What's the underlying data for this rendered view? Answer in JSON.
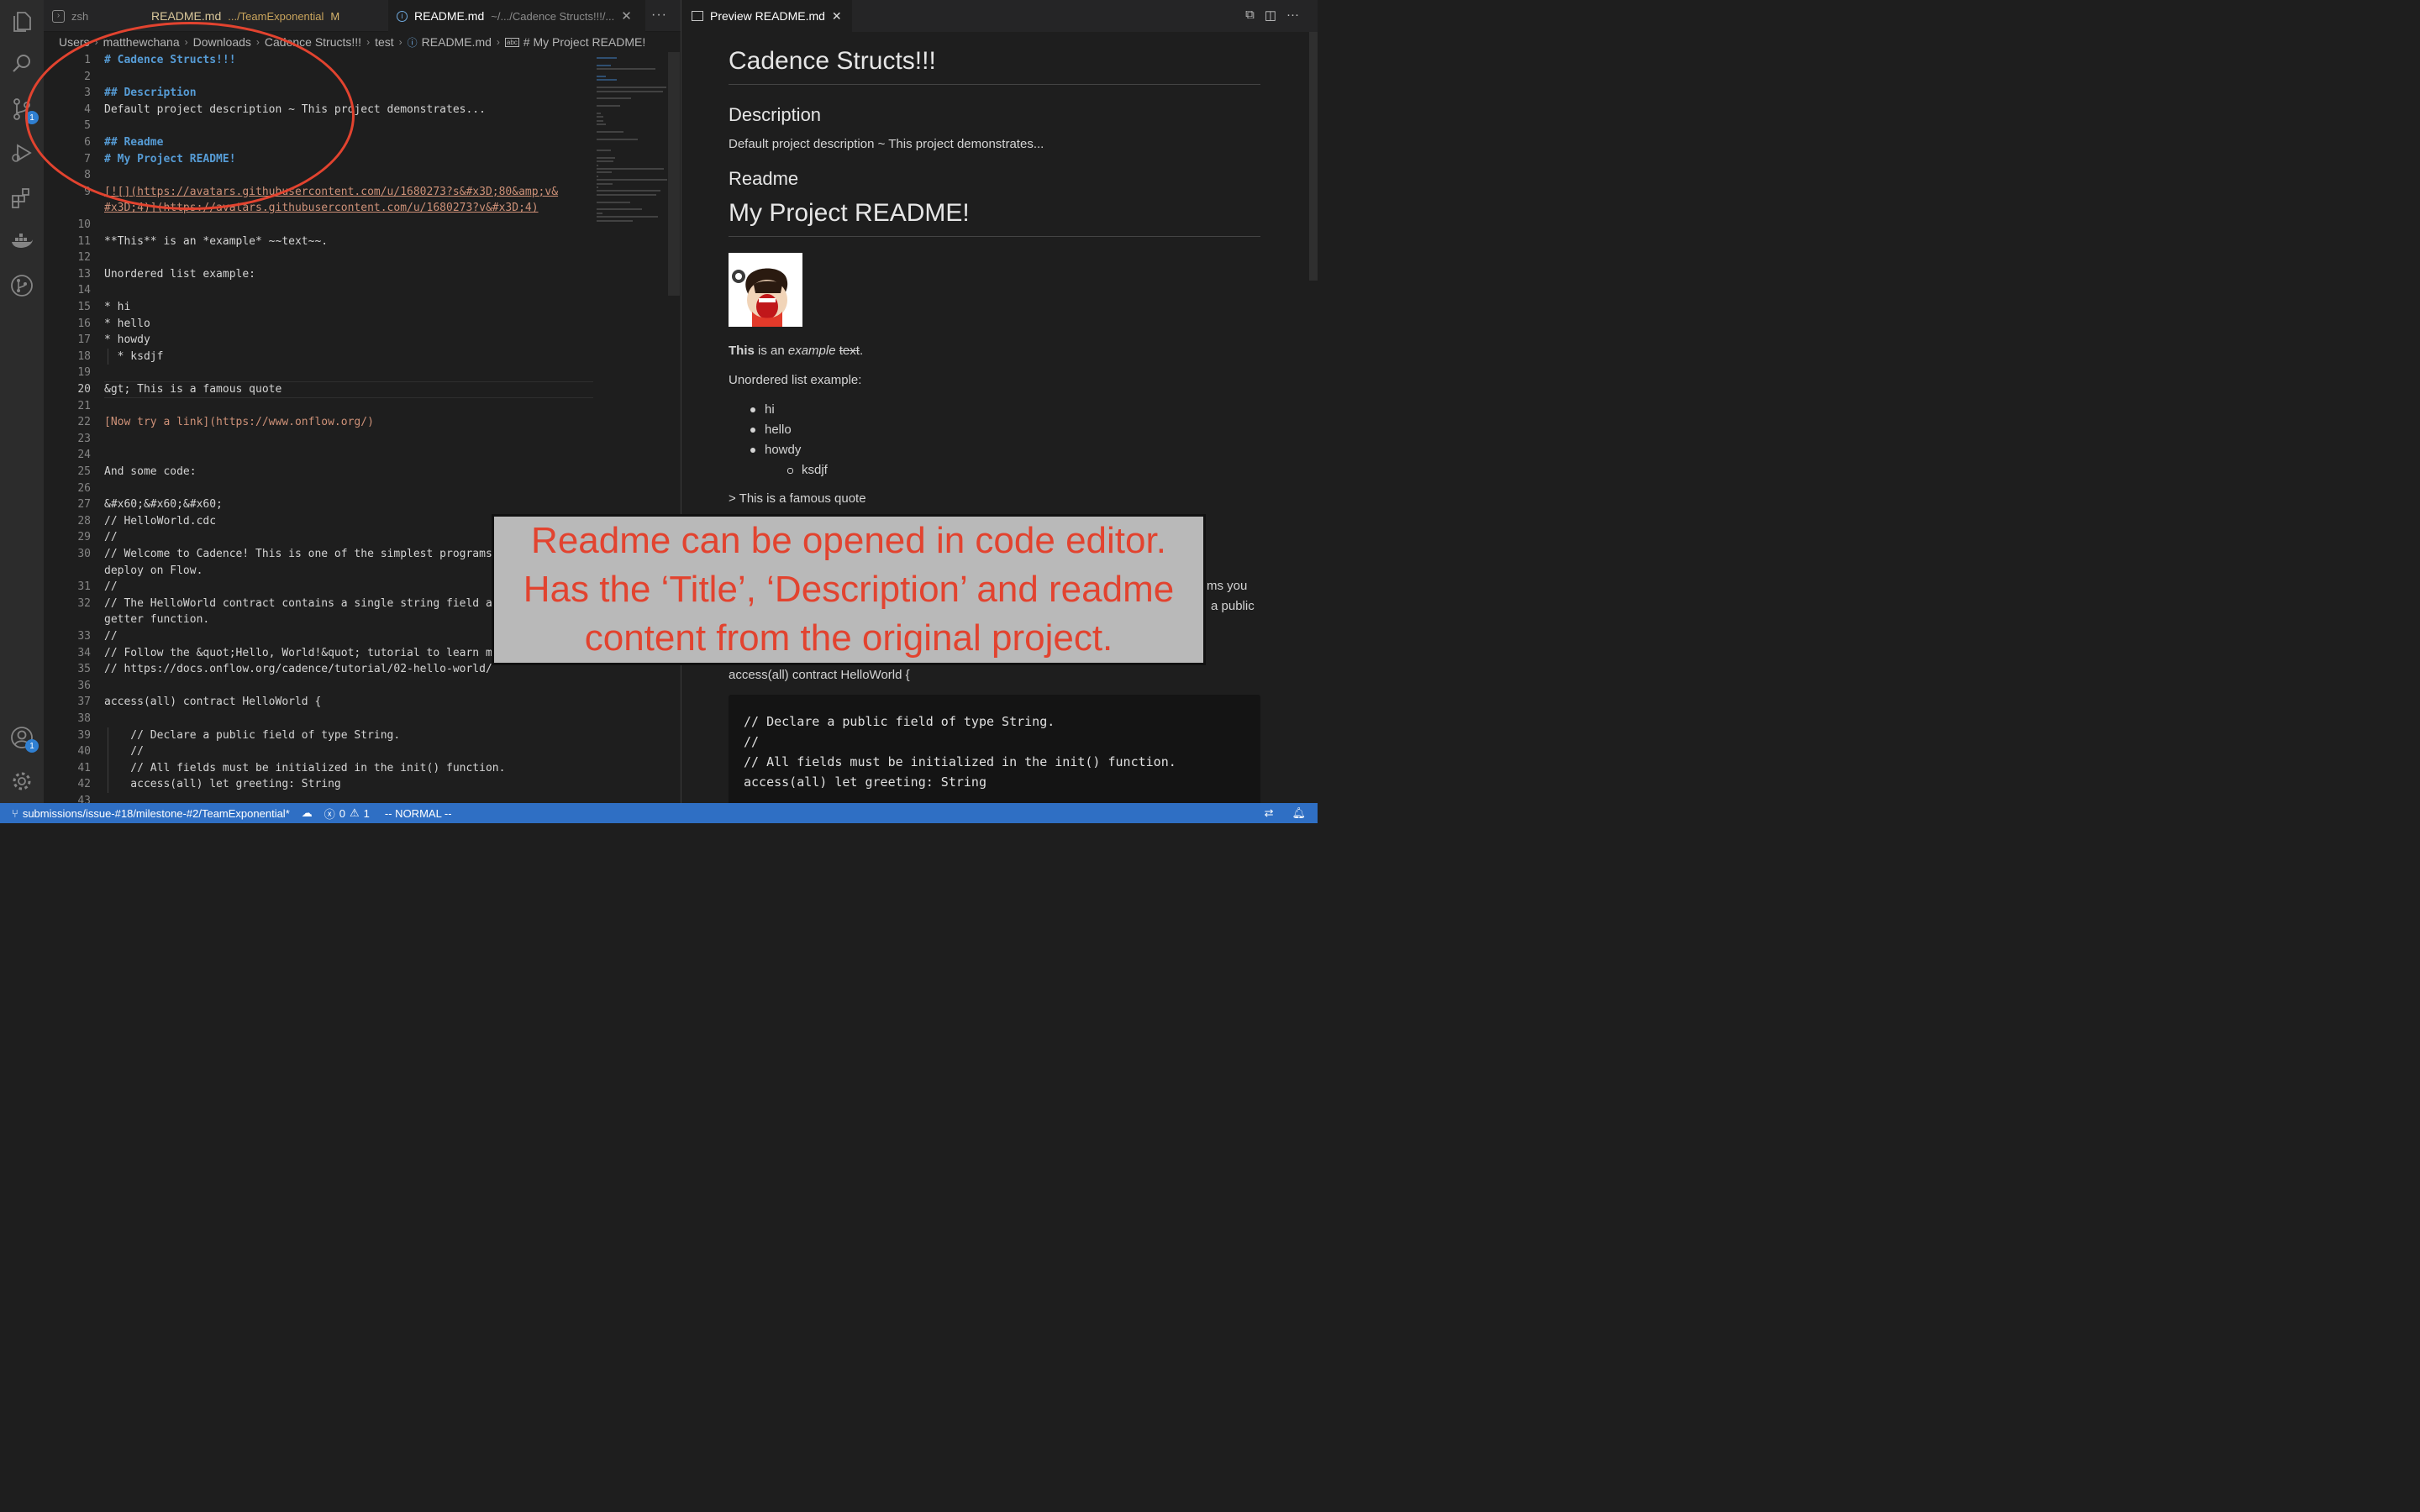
{
  "activity_bar": {
    "icons": [
      "explorer-icon",
      "search-icon",
      "source-control-icon",
      "run-debug-icon",
      "extensions-icon",
      "docker-icon",
      "git-graph-icon",
      "accounts-icon",
      "settings-gear-icon"
    ],
    "source_control_badge": "1",
    "accounts_badge": "1"
  },
  "tabs": {
    "zsh": "zsh",
    "readme_modified": {
      "name": "README.md",
      "path": ".../TeamExponential",
      "status": "M"
    },
    "readme_active": {
      "name": "README.md",
      "path": "~/.../Cadence Structs!!!/..."
    },
    "more": "···"
  },
  "breadcrumb": [
    "Users",
    "matthewchana",
    "Downloads",
    "Cadence Structs!!!",
    "test",
    "README.md",
    "# My Project README!"
  ],
  "editor": {
    "current_line": "20",
    "lines": [
      {
        "n": "1",
        "text": "# Cadence Structs!!!",
        "style": "h"
      },
      {
        "n": "2",
        "text": ""
      },
      {
        "n": "3",
        "text": "## Description",
        "style": "h"
      },
      {
        "n": "4",
        "text": "Default project description ~ This project demonstrates..."
      },
      {
        "n": "5",
        "text": ""
      },
      {
        "n": "6",
        "text": "## Readme",
        "style": "h"
      },
      {
        "n": "7",
        "text": "# My Project README!",
        "style": "h"
      },
      {
        "n": "8",
        "text": ""
      },
      {
        "n": "9",
        "text": "[![](https://avatars.githubusercontent.com/u/1680273?s&#x3D;80&amp;v&",
        "style": "link"
      },
      {
        "n": "",
        "text": "#x3D;4)](https://avatars.githubusercontent.com/u/1680273?v&#x3D;4)",
        "style": "link"
      },
      {
        "n": "10",
        "text": ""
      },
      {
        "n": "11",
        "text": "**This** is an *example* ~~text~~."
      },
      {
        "n": "12",
        "text": ""
      },
      {
        "n": "13",
        "text": "Unordered list example:"
      },
      {
        "n": "14",
        "text": ""
      },
      {
        "n": "15",
        "text": "* hi"
      },
      {
        "n": "16",
        "text": "* hello"
      },
      {
        "n": "17",
        "text": "* howdy"
      },
      {
        "n": "18",
        "text": "  * ksdjf"
      },
      {
        "n": "19",
        "text": ""
      },
      {
        "n": "20",
        "text": "&gt; This is a famous quote"
      },
      {
        "n": "21",
        "text": ""
      },
      {
        "n": "22",
        "text": "[Now try a link](https://www.onflow.org/)",
        "style": "link2"
      },
      {
        "n": "23",
        "text": ""
      },
      {
        "n": "24",
        "text": ""
      },
      {
        "n": "25",
        "text": "And some code:"
      },
      {
        "n": "26",
        "text": ""
      },
      {
        "n": "27",
        "text": "&#x60;&#x60;&#x60;"
      },
      {
        "n": "28",
        "text": "// HelloWorld.cdc"
      },
      {
        "n": "29",
        "text": "//"
      },
      {
        "n": "30",
        "text": "// Welcome to Cadence! This is one of the simplest programs you can"
      },
      {
        "n": "",
        "text": "deploy on Flow."
      },
      {
        "n": "31",
        "text": "//"
      },
      {
        "n": "32",
        "text": "// The HelloWorld contract contains a single string field and a public"
      },
      {
        "n": "",
        "text": "getter function."
      },
      {
        "n": "33",
        "text": "//"
      },
      {
        "n": "34",
        "text": "// Follow the &quot;Hello, World!&quot; tutorial to learn more:"
      },
      {
        "n": "35",
        "text": "// https://docs.onflow.org/cadence/tutorial/02-hello-world/"
      },
      {
        "n": "36",
        "text": ""
      },
      {
        "n": "37",
        "text": "access(all) contract HelloWorld {"
      },
      {
        "n": "38",
        "text": ""
      },
      {
        "n": "39",
        "text": "    // Declare a public field of type String."
      },
      {
        "n": "40",
        "text": "    //"
      },
      {
        "n": "41",
        "text": "    // All fields must be initialized in the init() function."
      },
      {
        "n": "42",
        "text": "    access(all) let greeting: String"
      },
      {
        "n": "43",
        "text": ""
      }
    ]
  },
  "preview": {
    "tab_label": "Preview README.md",
    "h1_title": "Cadence Structs!!!",
    "h2_description": "Description",
    "description": "Default project description ~ This project demonstrates...",
    "h2_readme": "Readme",
    "h1_project": "My Project README!",
    "para_bold": "This",
    "para_mid": " is an ",
    "para_italic": "example",
    "para_space": " ",
    "para_strike": "text",
    "para_end": ".",
    "list_intro": "Unordered list example:",
    "list": [
      "hi",
      "hello",
      "howdy"
    ],
    "sublist": [
      "ksdjf"
    ],
    "quote": "> This is a famous quote",
    "partial_line1": "ms you",
    "partial_line2": "a public",
    "contract_line": "access(all) contract HelloWorld {",
    "code_block": [
      "// Declare a public field of type String.",
      "//",
      "// All fields must be initialized in the init() function.",
      "access(all) let greeting: String"
    ]
  },
  "status_bar": {
    "branch": "submissions/issue-#18/milestone-#2/TeamExponential*",
    "errors": "0",
    "warnings": "1",
    "mode": "-- NORMAL --"
  },
  "annotation": {
    "text": "Readme can be opened in code editor. Has the ‘Title’, ‘Description’ and readme content from the original project.",
    "color": "#e2432f"
  }
}
